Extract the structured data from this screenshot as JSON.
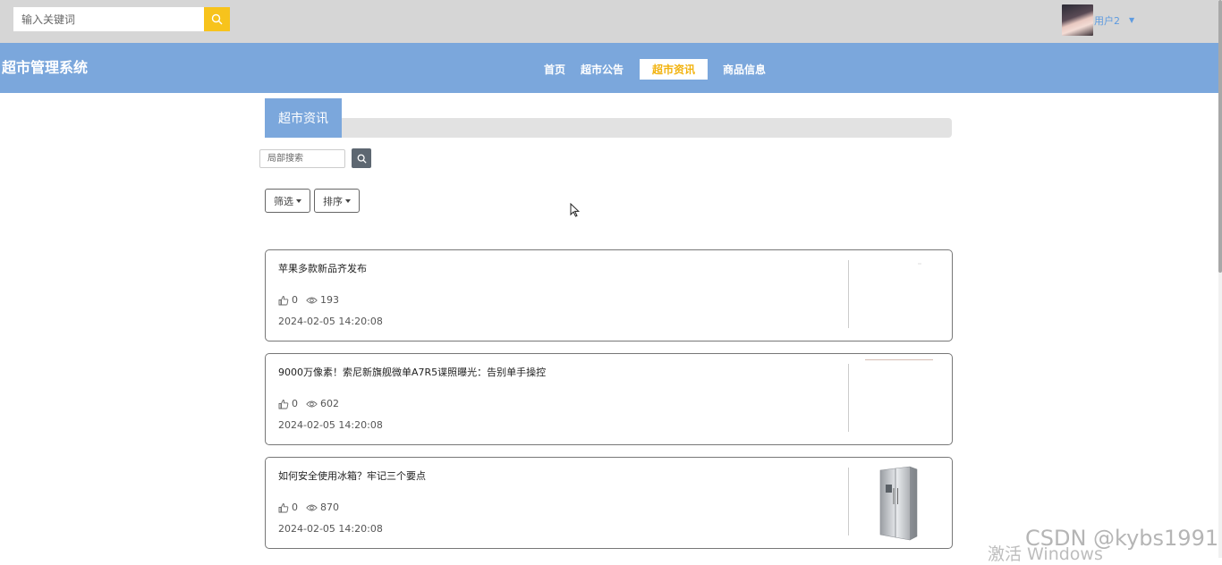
{
  "topbar": {
    "search_placeholder": "输入关键词",
    "user_name": "用户2"
  },
  "brand": "超市管理系统",
  "nav": [
    {
      "label": "首页",
      "active": false
    },
    {
      "label": "超市公告",
      "active": false
    },
    {
      "label": "超市资讯",
      "active": true
    },
    {
      "label": "商品信息",
      "active": false
    }
  ],
  "section": {
    "title": "超市资讯",
    "local_search_placeholder": "局部搜索",
    "filter_label": "筛选",
    "sort_label": "排序"
  },
  "articles": [
    {
      "title": "苹果多款新品齐发布",
      "likes": "0",
      "views": "193",
      "date": "2024-02-05 14:20:08",
      "thumb": "blank"
    },
    {
      "title": "9000万像素！索尼新旗舰微单A7R5谍照曝光：告别单手操控",
      "likes": "0",
      "views": "602",
      "date": "2024-02-05 14:20:08",
      "thumb": "line"
    },
    {
      "title": "如何安全使用冰箱？牢记三个要点",
      "likes": "0",
      "views": "870",
      "date": "2024-02-05 14:20:08",
      "thumb": "fridge"
    }
  ],
  "watermarks": {
    "csdn": "CSDN @kybs1991",
    "windows": "激活 Windows"
  },
  "colors": {
    "nav_bg": "#7ba7dc",
    "accent": "#f7c31c",
    "topbar_bg": "#d6d6d6"
  }
}
